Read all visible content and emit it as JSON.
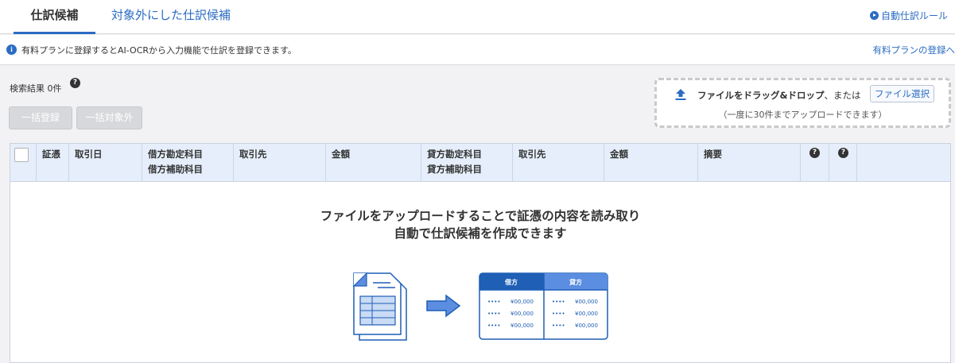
{
  "tabs": {
    "active": "仕訳候補",
    "inactive": "対象外にした仕訳候補",
    "rule_link": "自動仕訳ルール"
  },
  "info": {
    "text": "有料プランに登録するとAI-OCRから入力機能で仕訳を登録できます。",
    "link": "有料プランの登録へ"
  },
  "search": {
    "result_label": "検索結果 0件"
  },
  "buttons": {
    "bulk_register": "一括登録",
    "bulk_exclude": "一括対象外"
  },
  "dropzone": {
    "text_bold": "ファイルをドラッグ&ドロップ",
    "text_rest": "、または",
    "file_select": "ファイル選択",
    "sub": "（一度に30件までアップロードできます）"
  },
  "table": {
    "headers": {
      "voucher": "証憑",
      "date": "取引日",
      "debit_account": "借方勘定科目",
      "debit_sub": "借方補助科目",
      "debit_partner": "取引先",
      "debit_amount": "金額",
      "credit_account": "貸方勘定科目",
      "credit_sub": "貸方補助科目",
      "credit_partner": "取引先",
      "credit_amount": "金額",
      "memo": "摘要"
    },
    "empty_line1": "ファイルをアップロードすることで証憑の内容を読み取り",
    "empty_line2": "自動で仕訳候補を作成できます"
  },
  "illustration": {
    "debit_label": "借方",
    "credit_label": "貸方",
    "amount": "¥00,000",
    "dots": "••••"
  },
  "colors": {
    "accent": "#2b6cc2",
    "illustration_blue": "#1f5fb5",
    "illustration_light": "#5b8ee0"
  }
}
